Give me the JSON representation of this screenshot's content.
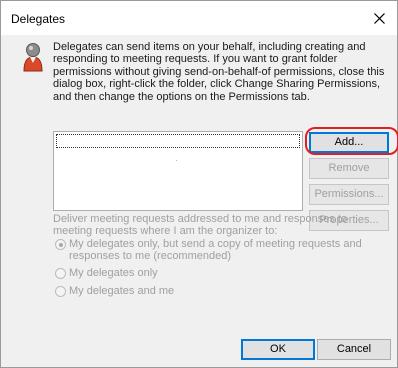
{
  "window": {
    "title": "Delegates"
  },
  "description": "Delegates can send items on your behalf, including creating and responding to meeting requests. If you want to grant folder permissions without giving send-on-behalf-of permissions, close this dialog box, right-click the folder, click Change Sharing Permissions, and then change the options on the Permissions tab.",
  "delegates_list": {
    "items": []
  },
  "buttons": {
    "add": "Add...",
    "remove": "Remove",
    "permissions": "Permissions...",
    "properties": "Properties...",
    "ok": "OK",
    "cancel": "Cancel"
  },
  "deliver": {
    "label": "Deliver meeting requests addressed to me and responses to meeting requests where I am the organizer to:",
    "options": [
      {
        "label": "My delegates only, but send a copy of meeting requests and responses to me (recommended)",
        "selected": true
      },
      {
        "label": "My delegates only",
        "selected": false
      },
      {
        "label": "My delegates and me",
        "selected": false
      }
    ]
  },
  "icons": {
    "close": "close-icon",
    "avatar": "user-avatar-icon"
  },
  "colors": {
    "highlight_ring": "#e02020",
    "default_button_border": "#0078d7"
  }
}
